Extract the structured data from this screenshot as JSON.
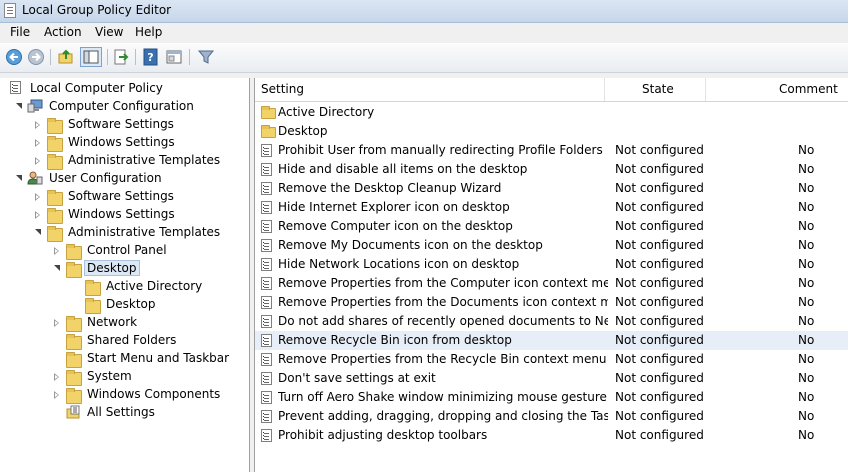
{
  "window": {
    "title": "Local Group Policy Editor"
  },
  "menu": [
    "File",
    "Action",
    "View",
    "Help"
  ],
  "toolbar": {
    "icons": [
      "back-arrow-icon",
      "forward-arrow-icon",
      "up-folder-icon",
      "show-hide-tree-icon",
      "export-list-icon",
      "help-icon",
      "properties-icon",
      "filter-icon"
    ]
  },
  "tree": {
    "root": "Local Computer Policy",
    "computer_config": "Computer Configuration",
    "cc_software": "Software Settings",
    "cc_windows": "Windows Settings",
    "cc_admin": "Administrative Templates",
    "user_config": "User Configuration",
    "uc_software": "Software Settings",
    "uc_windows": "Windows Settings",
    "uc_admin": "Administrative Templates",
    "control_panel": "Control Panel",
    "desktop": "Desktop",
    "active_directory": "Active Directory",
    "desktop_sub": "Desktop",
    "network": "Network",
    "shared_folders": "Shared Folders",
    "start_menu": "Start Menu and Taskbar",
    "system": "System",
    "windows_components": "Windows Components",
    "all_settings": "All Settings"
  },
  "list": {
    "columns": {
      "setting": "Setting",
      "state": "State",
      "comment": "Comment"
    },
    "folders": [
      "Active Directory",
      "Desktop"
    ],
    "rows": [
      {
        "setting": "Prohibit User from manually redirecting Profile Folders",
        "state": "Not configured",
        "comment": "No"
      },
      {
        "setting": "Hide and disable all items on the desktop",
        "state": "Not configured",
        "comment": "No"
      },
      {
        "setting": "Remove the Desktop Cleanup Wizard",
        "state": "Not configured",
        "comment": "No"
      },
      {
        "setting": "Hide Internet Explorer icon on desktop",
        "state": "Not configured",
        "comment": "No"
      },
      {
        "setting": "Remove Computer icon on the desktop",
        "state": "Not configured",
        "comment": "No"
      },
      {
        "setting": "Remove My Documents icon on the desktop",
        "state": "Not configured",
        "comment": "No"
      },
      {
        "setting": "Hide Network Locations icon on desktop",
        "state": "Not configured",
        "comment": "No"
      },
      {
        "setting": "Remove Properties from the Computer icon context menu",
        "state": "Not configured",
        "comment": "No"
      },
      {
        "setting": "Remove Properties from the Documents icon context menu",
        "state": "Not configured",
        "comment": "No"
      },
      {
        "setting": "Do not add shares of recently opened documents to Networ...",
        "state": "Not configured",
        "comment": "No"
      },
      {
        "setting": "Remove Recycle Bin icon from desktop",
        "state": "Not configured",
        "comment": "No"
      },
      {
        "setting": "Remove Properties from the Recycle Bin context menu",
        "state": "Not configured",
        "comment": "No"
      },
      {
        "setting": "Don't save settings at exit",
        "state": "Not configured",
        "comment": "No"
      },
      {
        "setting": "Turn off Aero Shake window minimizing mouse gesture",
        "state": "Not configured",
        "comment": "No"
      },
      {
        "setting": "Prevent adding, dragging, dropping and closing the Taskbar...",
        "state": "Not configured",
        "comment": "No"
      },
      {
        "setting": "Prohibit adjusting desktop toolbars",
        "state": "Not configured",
        "comment": "No"
      }
    ]
  }
}
